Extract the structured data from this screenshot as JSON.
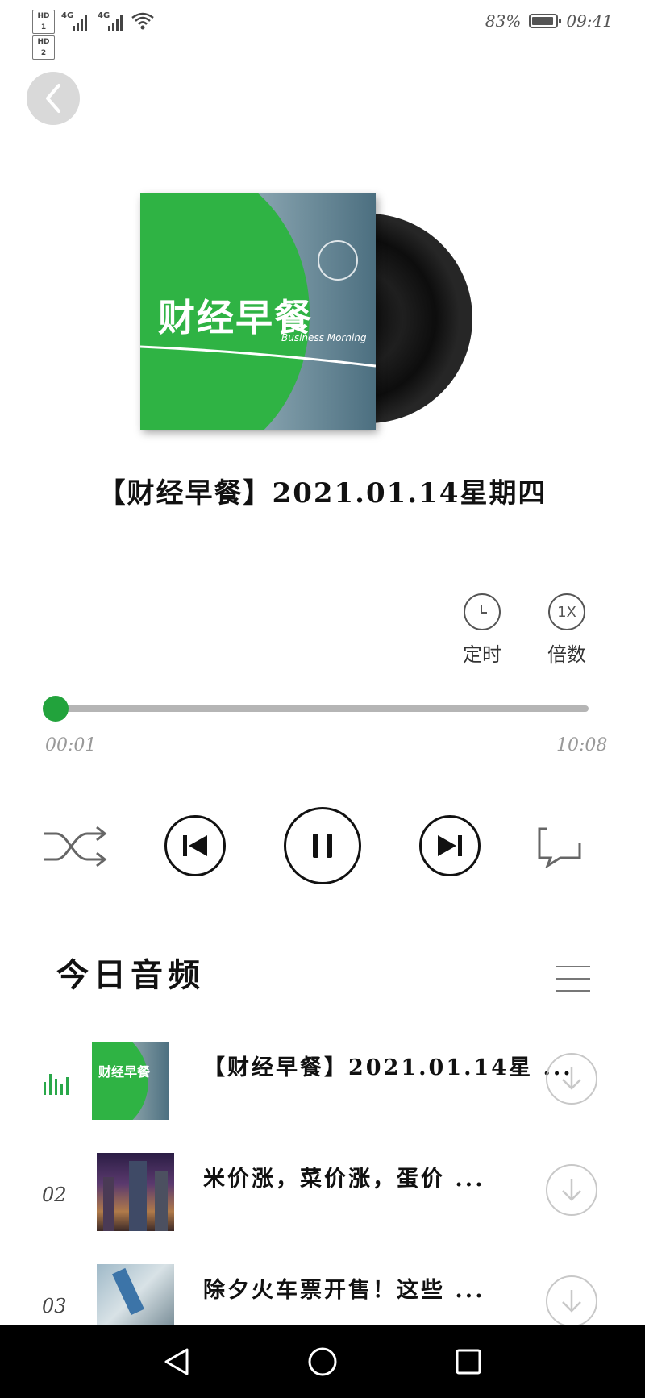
{
  "status_bar": {
    "hd_labels": [
      "HD 1",
      "HD 2"
    ],
    "network_1": "4G",
    "network_2": "4G",
    "battery_text": "83%",
    "time": "09:41"
  },
  "nav": {
    "back_icon": "chevron-left-icon"
  },
  "album": {
    "cover_title": "财经早餐",
    "cover_subtitle": "Business Morning"
  },
  "player": {
    "title": "【财经早餐】2021.01.14星期四",
    "timer_label": "定时",
    "speed_badge": "1X",
    "speed_label": "倍数",
    "elapsed": "00:01",
    "duration": "10:08",
    "progress": 0.002
  },
  "controls": {
    "shuffle_icon": "shuffle-icon",
    "prev_icon": "skip-previous-icon",
    "pause_icon": "pause-icon",
    "next_icon": "skip-next-icon",
    "comment_icon": "comment-icon"
  },
  "playlist": {
    "heading": "今日音频",
    "items": [
      {
        "index": "",
        "playing": true,
        "title": "【财经早餐】2021.01.14星 ...",
        "thumb_title": "财经早餐"
      },
      {
        "index": "02",
        "playing": false,
        "title": "米价涨，菜价涨，蛋价 ..."
      },
      {
        "index": "03",
        "playing": false,
        "title": "除夕火车票开售！这些 ..."
      }
    ]
  },
  "colors": {
    "accent": "#22a33c",
    "track": "#b5b5b5",
    "nav_bar": "#000000"
  }
}
